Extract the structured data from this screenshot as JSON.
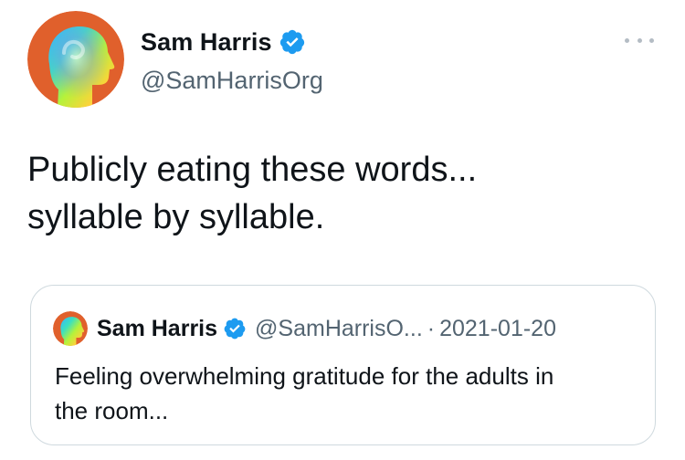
{
  "author": {
    "display_name": "Sam Harris",
    "handle": "@SamHarrisOrg",
    "verified": true,
    "avatar_icon": "head-profile-avatar"
  },
  "more_menu_icon": "more-options-icon",
  "tweet": {
    "text_lines": [
      "Publicly eating these words...",
      "syllable by syllable."
    ]
  },
  "quoted_tweet": {
    "display_name": "Sam Harris",
    "handle": "@SamHarrisO...",
    "separator": "·",
    "date": "2021-01-20",
    "verified": true,
    "text_lines": [
      "Feeling overwhelming gratitude for the adults in",
      "the room..."
    ]
  },
  "colors": {
    "verified_blue": "#1d9bf0",
    "secondary_text": "#536471",
    "border": "#cfd9de",
    "avatar_background": "#e0602c"
  }
}
